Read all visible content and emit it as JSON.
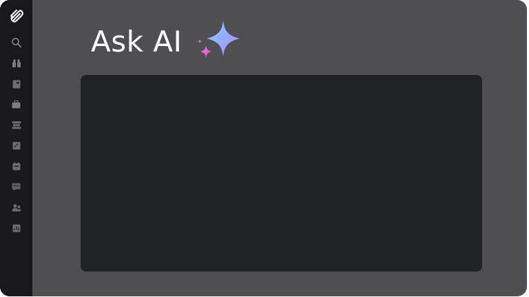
{
  "page": {
    "title": "Ask AI"
  },
  "sidebar": {
    "logo": "app-logo-icon",
    "items": [
      {
        "icon": "search-icon"
      },
      {
        "icon": "binoculars-icon"
      },
      {
        "icon": "document-icon"
      },
      {
        "icon": "briefcase-icon"
      },
      {
        "icon": "list-icon"
      },
      {
        "icon": "note-icon"
      },
      {
        "icon": "calendar-icon"
      },
      {
        "icon": "chat-icon"
      },
      {
        "icon": "people-icon"
      },
      {
        "icon": "report-icon"
      }
    ]
  },
  "colors": {
    "background": "#4f4e53",
    "sidebar": "#19191c",
    "panel": "#212226",
    "sparkle_large": "#8fb8ff",
    "sparkle_small": "#e85fc8"
  }
}
